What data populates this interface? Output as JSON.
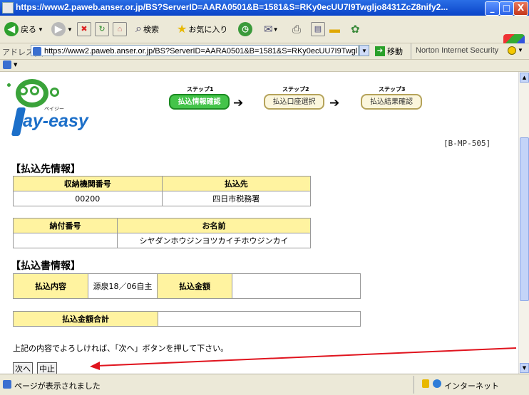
{
  "window": {
    "title": "https://www2.paweb.anser.or.jp/BS?ServerID=AARA0501&B=1581&S=RKy0ecUU7I9Twgljo8431ZcZ8nify2...",
    "minimize": "_",
    "maximize": "□",
    "close": "X"
  },
  "toolbar": {
    "back_label": "戻る",
    "search_label": "検索",
    "favorites_label": "お気に入り"
  },
  "address": {
    "label": "アドレス(D)",
    "url": "https://www2.paweb.anser.or.jp/BS?ServerID=AARA0501&B=1581&S=RKy0ecUU7I9Twgl",
    "go_label": "移動",
    "norton_label": "Norton Internet Security"
  },
  "page": {
    "logo_small": "ペイジー",
    "logo_main": "ay-easy",
    "steps": [
      {
        "num": "ステップ1",
        "label": "払込情報確認"
      },
      {
        "num": "ステップ2",
        "label": "払込口座選択"
      },
      {
        "num": "ステップ3",
        "label": "払込結果確認"
      }
    ],
    "code": "[B-MP-505]",
    "payee_section": "【払込先情報】",
    "payee_table": {
      "h1": "収納機関番号",
      "h2": "払込先",
      "v1": "00200",
      "v2": "四日市税務署"
    },
    "pay_num_table": {
      "h1": "納付番号",
      "h2": "お名前",
      "v1": "",
      "v2": "シヤダンホウジンヨツカイチホウジンカイ"
    },
    "slip_section": "【払込書情報】",
    "slip_table": {
      "h1": "払込内容",
      "v1": "源泉18／06自主",
      "h2": "払込金額",
      "v2": ""
    },
    "total_table": {
      "h1": "払込金額合計",
      "v1": ""
    },
    "instruction": "上記の内容でよろしければ、「次へ」ボタンを押して下さい。",
    "next_button": "次へ",
    "cancel_button": "中止"
  },
  "status": {
    "text": "ページが表示されました",
    "zone": "インターネット"
  },
  "colors": {
    "title_bar": "#0a44c8",
    "header_cell": "#fff3a0",
    "active_step": "#44c44a",
    "arrow_annotation": "#e0141e"
  }
}
